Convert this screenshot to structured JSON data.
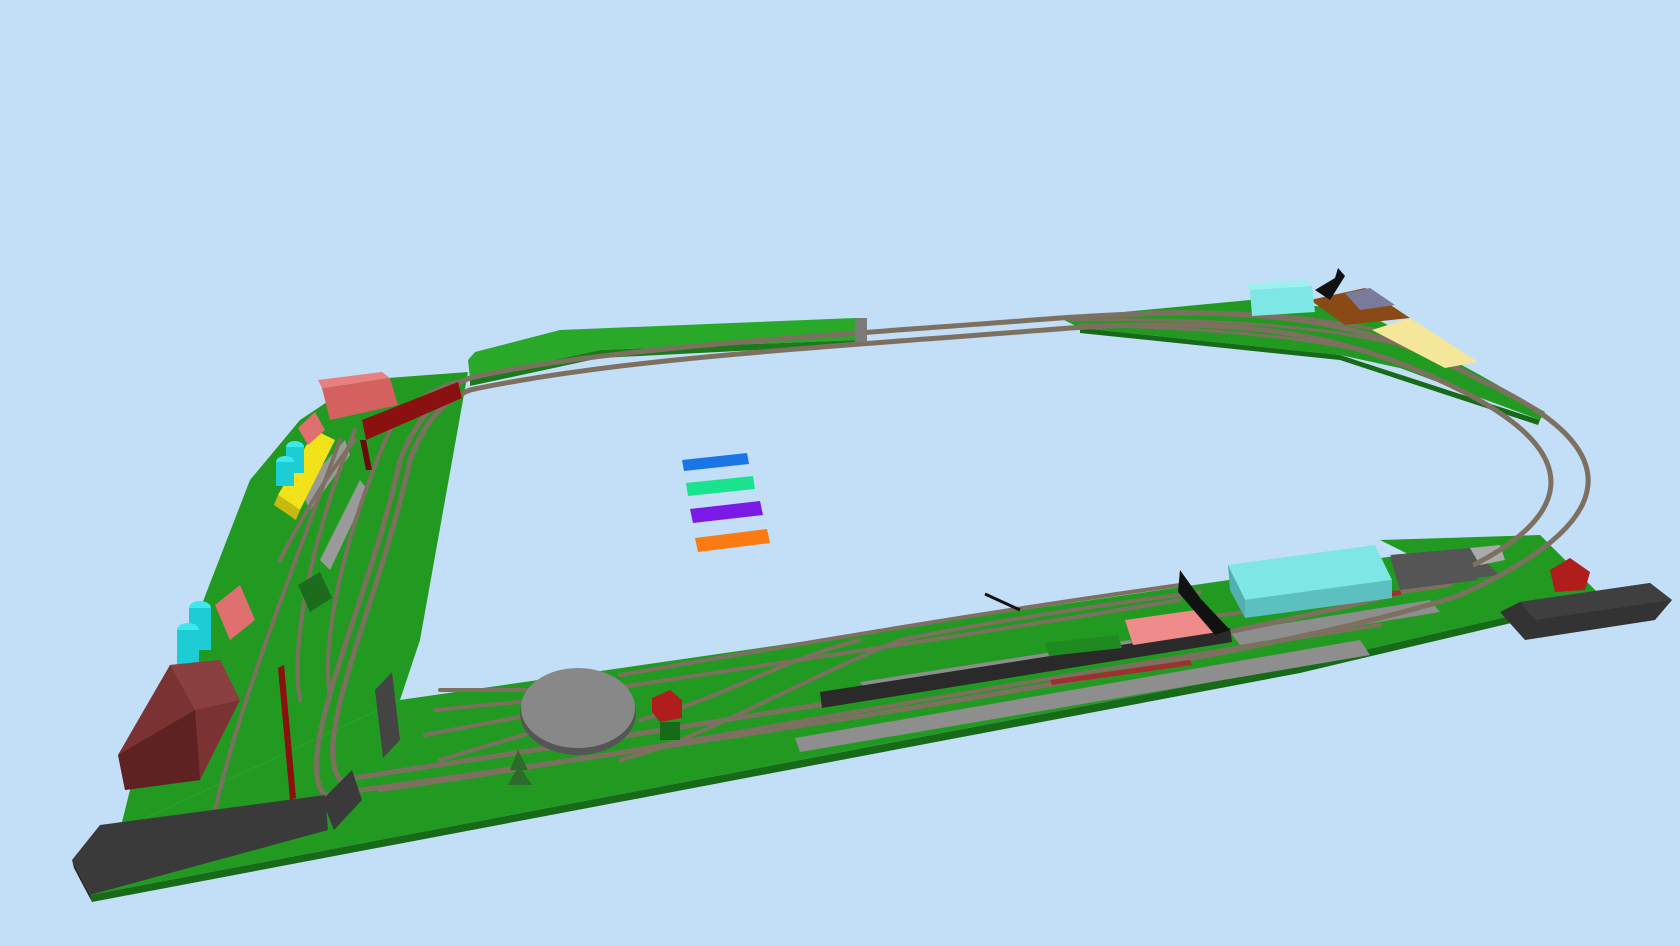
{
  "scene": {
    "background": "#c3def7",
    "baseboard_color": "#229a22",
    "track_color": "#8a8070",
    "platform_color": "#8e8e8e",
    "legend_swatches": [
      {
        "name": "blue-swatch",
        "color": "#1a76e6"
      },
      {
        "name": "teal-swatch",
        "color": "#19e38f"
      },
      {
        "name": "violet-swatch",
        "color": "#7b1ae6"
      },
      {
        "name": "orange-swatch",
        "color": "#fb7a12"
      }
    ],
    "buildings": {
      "light_blue": "#7fe6e6",
      "pink": "#f08b8b",
      "brown": "#7a3232",
      "dark_grey": "#3a3a3a",
      "yellow": "#f2e21a",
      "cyan_tanks": "#1ccdd6",
      "dark_red": "#8b1010",
      "salmon": "#e07070",
      "sand": "#f5e79a",
      "rust": "#8a4a16"
    }
  }
}
